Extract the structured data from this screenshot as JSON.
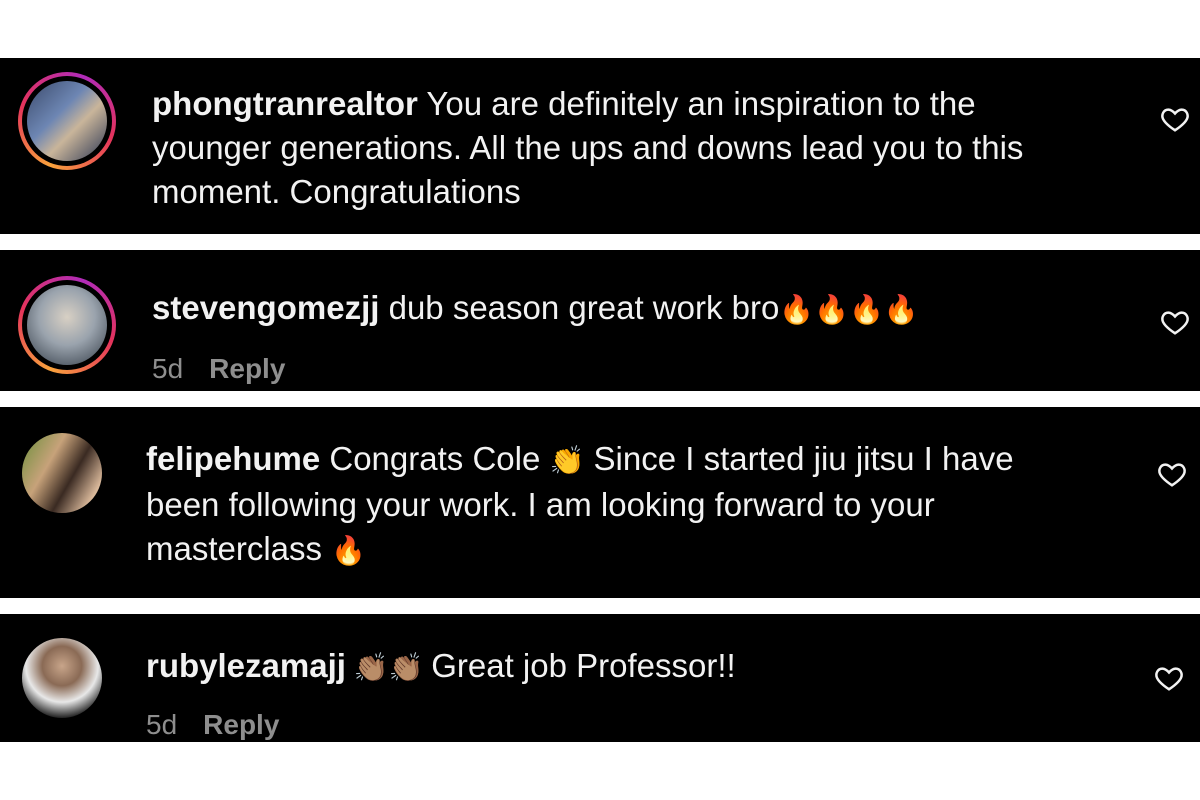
{
  "comments": [
    {
      "username": "phongtranrealtor",
      "text": " You are definitely an inspiration to the",
      "text_line2": "younger generations. All the ups and downs lead you to this",
      "text_line3": "moment. Congratulations",
      "avatar_ring": true
    },
    {
      "username": "stevengomezjj",
      "text": " dub season great work bro",
      "emojis": "🔥🔥🔥🔥",
      "time": "5d",
      "reply_label": "Reply",
      "avatar_ring": true
    },
    {
      "username": "felipehume",
      "text": " Congrats Cole ",
      "emoji_mid": "👏",
      "text_after": " Since I started jiu jitsu I have",
      "text_line2": "been following your work. I am looking forward to your",
      "text_line3": "masterclass ",
      "emoji_end": "🔥",
      "avatar_ring": false
    },
    {
      "username": "rubylezamajj",
      "emojis": " 👏🏽👏🏽 ",
      "text": "Great job Professor!!",
      "time": "5d",
      "reply_label": "Reply",
      "avatar_ring": false
    }
  ],
  "icons": {
    "like": "heart-outline-icon"
  },
  "colors": {
    "background": "#000000",
    "text": "#f2f2f2",
    "meta": "#8e8e8e",
    "ring_start": "#f9a23c",
    "ring_end": "#b02bb9"
  }
}
